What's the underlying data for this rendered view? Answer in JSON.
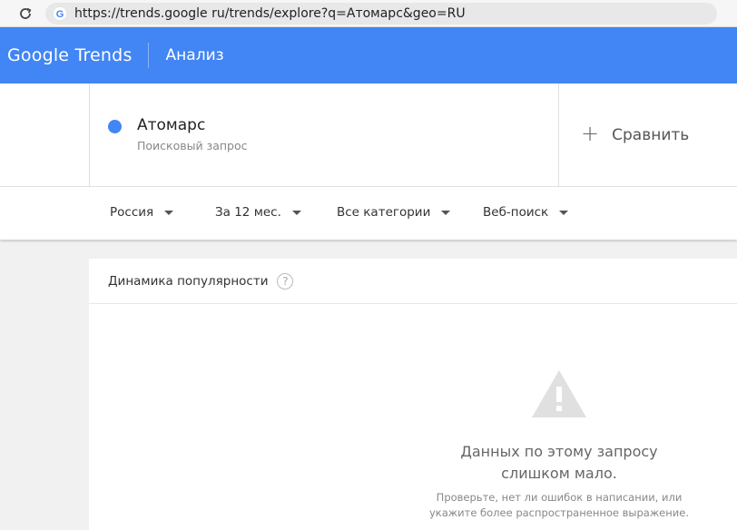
{
  "browser": {
    "url": "https://trends.google ru/trends/explore?q=Атомарс&geo=RU",
    "reload_icon": "reload-icon"
  },
  "header": {
    "logo": "Google Trends",
    "title": "Анализ",
    "background_color": "#4285f4"
  },
  "term": {
    "name": "Атомарс",
    "type": "Поисковый запрос",
    "dot_color": "#4285f4"
  },
  "compare": {
    "icon": "plus-icon",
    "label": "Сравнить"
  },
  "filters": {
    "region": "Россия",
    "period": "За 12 мес.",
    "category": "Все категории",
    "search_type": "Веб-поиск"
  },
  "chart_card": {
    "title": "Динамика популярности",
    "help_icon": "help-icon",
    "warning_icon": "warning-icon",
    "empty_title_line1": "Данных по этому запросу",
    "empty_title_line2": "слишком мало.",
    "empty_hint_line1": "Проверьте, нет ли ошибок в написании, или",
    "empty_hint_line2": "укажите более распространенное выражение."
  }
}
